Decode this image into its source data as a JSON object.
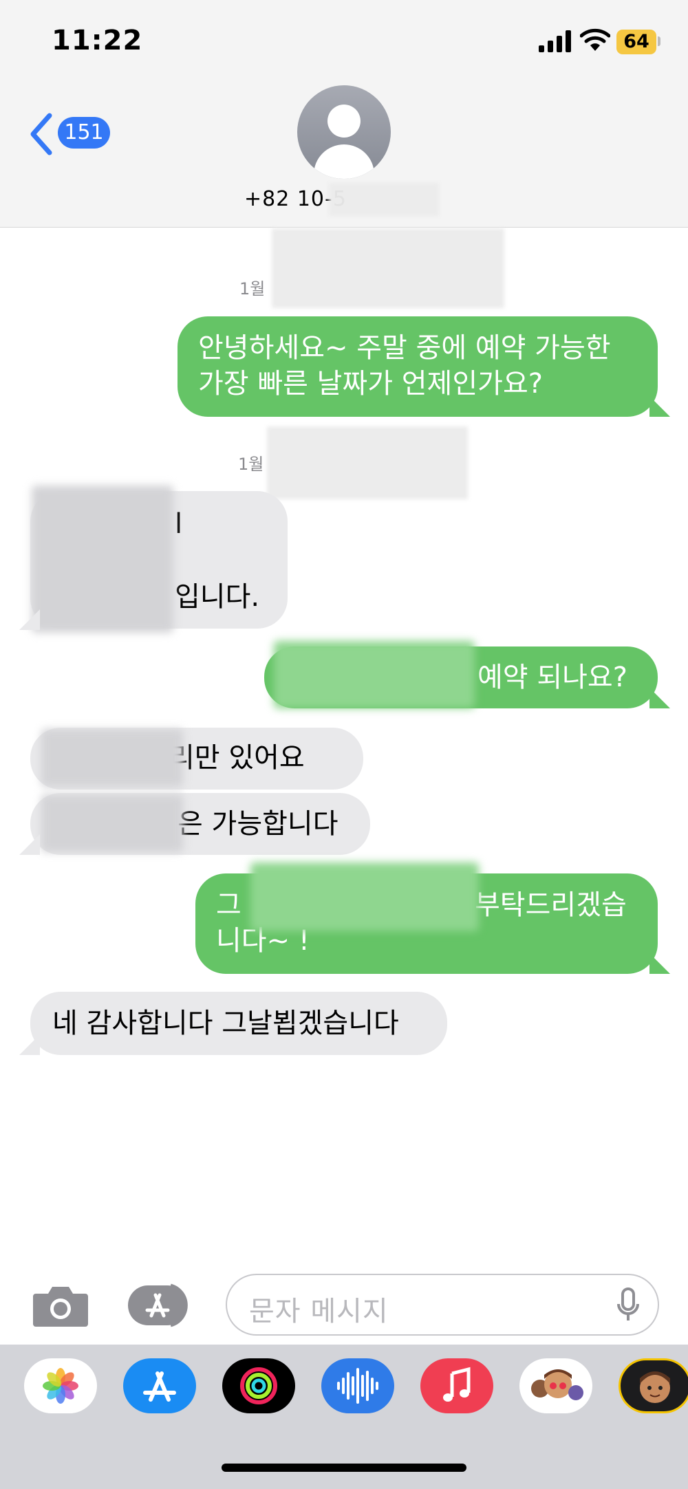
{
  "status_bar": {
    "time": "11:22",
    "battery": "64"
  },
  "header": {
    "back_count": "151",
    "contact_number": "+82 10-5"
  },
  "messages": [
    {
      "type": "timestamp",
      "text": "1월"
    },
    {
      "type": "outgoing",
      "lines": [
        "안녕하세요~ 주말 중에 예약 가능한",
        "가장 빠른 날짜가 언제인가요?"
      ]
    },
    {
      "type": "timestamp",
      "text": "1월"
    },
    {
      "type": "incoming",
      "lines": [
        "l",
        "",
        "입니다."
      ]
    },
    {
      "type": "outgoing",
      "lines": [
        "예약 되나요?"
      ]
    },
    {
      "type": "incoming",
      "lines": [
        "리만  있어요"
      ]
    },
    {
      "type": "incoming",
      "lines": [
        "은 가능합니다"
      ]
    },
    {
      "type": "outgoing",
      "lines": [
        "그",
        "부탁드리겠습",
        "니다~ !"
      ]
    },
    {
      "type": "incoming",
      "lines": [
        "네 감사합니다 그날뵙겠습니다"
      ]
    }
  ],
  "input": {
    "placeholder": "문자 메시지"
  },
  "icons": {
    "back": "chevron-left-icon",
    "camera": "camera-icon",
    "apps": "app-store-icon",
    "mic": "microphone-icon",
    "drawer": [
      "photos-icon",
      "app-store-icon",
      "fitness-icon",
      "voice-memos-icon",
      "music-icon",
      "memoji-stickers-icon",
      "memoji-icon"
    ]
  },
  "colors": {
    "outgoing": "#65c466",
    "incoming": "#e9e9eb",
    "accent": "#3478f6",
    "battery": "#f5c742"
  }
}
